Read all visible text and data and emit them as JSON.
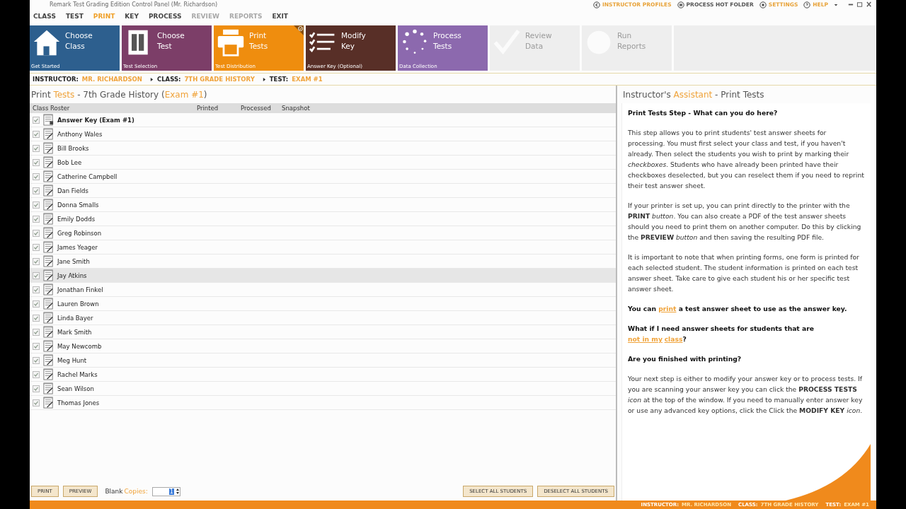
{
  "window": {
    "title": "Remark Test Grading Edition Control Panel (Mr. Richardson)"
  },
  "menu": [
    {
      "label": "CLASS",
      "selected": false,
      "disabled": false
    },
    {
      "label": "TEST",
      "selected": false,
      "disabled": false
    },
    {
      "label": "PRINT",
      "selected": true,
      "disabled": false
    },
    {
      "label": "KEY",
      "selected": false,
      "disabled": false
    },
    {
      "label": "PROCESS",
      "selected": false,
      "disabled": false
    },
    {
      "label": "REVIEW",
      "selected": false,
      "disabled": true
    },
    {
      "label": "REPORTS",
      "selected": false,
      "disabled": true
    },
    {
      "label": "EXIT",
      "selected": false,
      "disabled": false
    }
  ],
  "top_links": [
    {
      "label": "INSTRUCTOR PROFILES",
      "kind": "back",
      "highlight": true
    },
    {
      "label": "PROCESS HOT FOLDER",
      "kind": "folder",
      "highlight": false
    },
    {
      "label": "SETTINGS",
      "kind": "gear",
      "highlight": true
    },
    {
      "label": "HELP",
      "kind": "help",
      "highlight": true
    }
  ],
  "tiles": [
    {
      "kind": "house",
      "title": [
        "Choose",
        "Class"
      ],
      "caption": "Get Started",
      "color": "#2d5f8e",
      "selected": false,
      "disabled": false
    },
    {
      "kind": "document",
      "title": [
        "Choose",
        "Test"
      ],
      "caption": "Test Selection",
      "color": "#7c3e68",
      "selected": false,
      "disabled": false
    },
    {
      "kind": "printer",
      "title": [
        "Print",
        "Tests"
      ],
      "caption": "Test Distribution",
      "color": "#ef8d0e",
      "selected": true,
      "disabled": false
    },
    {
      "kind": "checklist",
      "title": [
        "Modify",
        "Key"
      ],
      "caption": "Answer Key (Optional)",
      "color": "#582f27",
      "selected": false,
      "disabled": false
    },
    {
      "kind": "spinner",
      "title": [
        "Process",
        "Tests"
      ],
      "caption": "Data Collection",
      "color": "#8c69ae",
      "selected": false,
      "disabled": false
    },
    {
      "kind": "check",
      "title": [
        "Review",
        "Data"
      ],
      "color": "#eeeeee",
      "selected": false,
      "disabled": true
    },
    {
      "kind": "pie",
      "title": [
        "Run",
        "Reports"
      ],
      "color": "#eeeeee",
      "selected": false,
      "disabled": true
    }
  ],
  "breadcrumb": [
    {
      "label": "INSTRUCTOR:",
      "value": "MR. RICHARDSON"
    },
    {
      "label": "CLASS:",
      "value": "7TH GRADE HISTORY"
    },
    {
      "label": "TEST:",
      "value": "EXAM #1"
    }
  ],
  "roster": {
    "title": [
      {
        "text": "Print ",
        "accent": false
      },
      {
        "text": "Tests",
        "accent": true
      },
      {
        "text": " - 7th Grade History (",
        "accent": false
      },
      {
        "text": "Exam #1",
        "accent": true
      },
      {
        "text": ")",
        "accent": false
      }
    ],
    "columns": [
      "Class Roster",
      "Printed",
      "Processed",
      "Snapshot"
    ],
    "rows": [
      {
        "kind": "key",
        "name": "Answer Key (Exam #1)",
        "checked": true,
        "selected": false
      },
      {
        "kind": "student",
        "name": "Anthony Wales",
        "checked": true,
        "selected": false
      },
      {
        "kind": "student",
        "name": "Bill Brooks",
        "checked": true,
        "selected": false
      },
      {
        "kind": "student",
        "name": "Bob Lee",
        "checked": true,
        "selected": false
      },
      {
        "kind": "student",
        "name": "Catherine Campbell",
        "checked": true,
        "selected": false
      },
      {
        "kind": "student",
        "name": "Dan Fields",
        "checked": true,
        "selected": false
      },
      {
        "kind": "student",
        "name": "Donna Smalls",
        "checked": true,
        "selected": false
      },
      {
        "kind": "student",
        "name": "Emily Dodds",
        "checked": true,
        "selected": false
      },
      {
        "kind": "student",
        "name": "Greg Robinson",
        "checked": true,
        "selected": false
      },
      {
        "kind": "student",
        "name": "James Yeager",
        "checked": true,
        "selected": false
      },
      {
        "kind": "student",
        "name": "Jane Smith",
        "checked": true,
        "selected": false
      },
      {
        "kind": "student",
        "name": "Jay Atkins",
        "checked": true,
        "selected": true
      },
      {
        "kind": "student",
        "name": "Jonathan Finkel",
        "checked": true,
        "selected": false
      },
      {
        "kind": "student",
        "name": "Lauren Brown",
        "checked": true,
        "selected": false
      },
      {
        "kind": "student",
        "name": "Linda Bayer",
        "checked": true,
        "selected": false
      },
      {
        "kind": "student",
        "name": "Mark Smith",
        "checked": true,
        "selected": false
      },
      {
        "kind": "student",
        "name": "May Newcomb",
        "checked": true,
        "selected": false
      },
      {
        "kind": "student",
        "name": "Meg Hunt",
        "checked": true,
        "selected": false
      },
      {
        "kind": "student",
        "name": "Rachel Marks",
        "checked": true,
        "selected": false
      },
      {
        "kind": "student",
        "name": "Sean Wilson",
        "checked": true,
        "selected": false
      },
      {
        "kind": "student",
        "name": "Thomas Jones",
        "checked": true,
        "selected": false
      }
    ]
  },
  "footer": {
    "buttons_left": [
      "PRINT",
      "PREVIEW"
    ],
    "blank_label": "Blank",
    "copies_label": "Copies:",
    "copies_value": "1",
    "buttons_right": [
      "SELECT ALL STUDENTS",
      "DESELECT ALL STUDENTS"
    ]
  },
  "assistant": {
    "title": [
      {
        "text": "Instructor's ",
        "accent": false
      },
      {
        "text": "Assistant",
        "accent": true
      },
      {
        "text": " - Print Tests",
        "accent": false
      }
    ],
    "blocks": [
      {
        "kind": "heading",
        "parts": [
          {
            "kind": "text",
            "text": "Print Tests Step - What can you do here?"
          }
        ]
      },
      {
        "kind": "para",
        "parts": [
          {
            "kind": "text",
            "text": "This step allows you to print students' test answer sheets for processing. You must first select your class and test, if you haven't already. Then select the students you wish to print by marking their *checkboxes*. Students who have already been printed have their checkboxes deselected, but you can reselect them if you need to reprint their test answer sheet."
          }
        ]
      },
      {
        "kind": "para",
        "parts": [
          {
            "kind": "text",
            "text": "If your printer is set up, you can print directly to the printer with the **PRINT** *button*. You can also create a PDF of the test answer sheets should you need to print them on another computer. Do this by clicking the **PREVIEW** *button* and then saving the resulting PDF file."
          }
        ]
      },
      {
        "kind": "para",
        "parts": [
          {
            "kind": "text",
            "text": "It is important to note that when printing forms, one form is printed for each selected student. The student information is printed on each test answer sheet. Take care to give each student his or her specific test answer sheet."
          }
        ]
      },
      {
        "kind": "heading",
        "parts": [
          {
            "kind": "text",
            "text": "You can "
          },
          {
            "kind": "link",
            "text": "print"
          },
          {
            "kind": "text",
            "text": " a test answer sheet to use as the answer key."
          }
        ]
      },
      {
        "kind": "heading",
        "parts": [
          {
            "kind": "text",
            "text": "What if I need answer sheets for students that are "
          },
          {
            "kind": "link",
            "text": "not in my"
          },
          {
            "kind": "link",
            "text": "class"
          },
          {
            "kind": "text",
            "text": "?"
          }
        ]
      },
      {
        "kind": "heading",
        "parts": [
          {
            "kind": "text",
            "text": "Are you finished with printing?"
          }
        ]
      },
      {
        "kind": "para",
        "parts": [
          {
            "kind": "text",
            "text": "Your next step is either to modify your answer key or to process tests. If you are scanning your answer key you can click the **PROCESS TESTS** *icon* at the top of the window. If you need to manually enter answer key or use any advanced key options, click the Click the **MODIFY KEY** *icon*."
          }
        ]
      }
    ]
  },
  "status_bar": [
    {
      "label": "INSTRUCTOR:",
      "value": "MR. RICHARDSON"
    },
    {
      "label": "CLASS:",
      "value": "7TH GRADE HISTORY"
    },
    {
      "label": "TEST:",
      "value": "EXAM #1"
    }
  ]
}
